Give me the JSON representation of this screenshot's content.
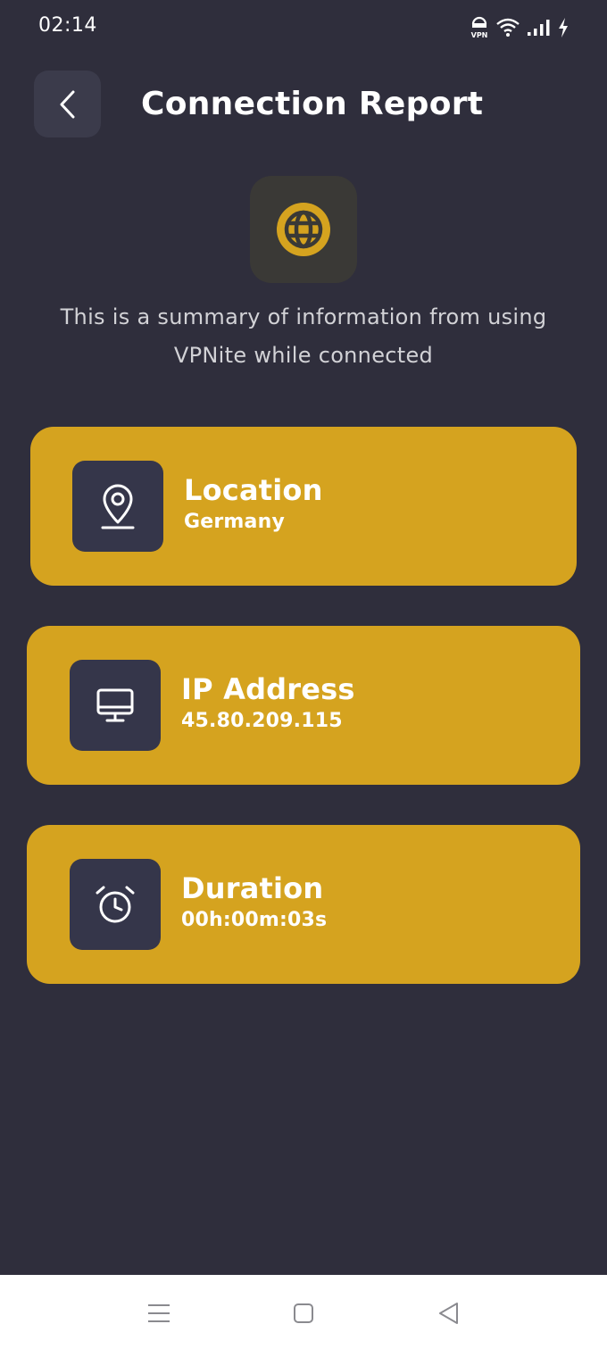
{
  "status_bar": {
    "time": "02:14",
    "icons": [
      "vpn-icon",
      "wifi-icon",
      "signal-icon",
      "charging-icon"
    ],
    "vpn_label": "VPN"
  },
  "header": {
    "title": "Connection Report",
    "back_icon": "chevron-left-icon"
  },
  "hero": {
    "icon": "globe-icon",
    "summary": "This is a summary of information from using VPNite while connected"
  },
  "cards": [
    {
      "title": "Location",
      "value": "Germany",
      "icon": "location-pin-icon"
    },
    {
      "title": "IP Address",
      "value": "45.80.209.115",
      "icon": "monitor-icon"
    },
    {
      "title": "Duration",
      "value": "00h:00m:03s",
      "icon": "alarm-clock-icon"
    }
  ],
  "nav_bar": {
    "buttons": [
      "menu-icon",
      "home-icon",
      "back-triangle-icon"
    ]
  },
  "colors": {
    "background": "#2f2e3c",
    "card": "#d5a31f",
    "icon_box": "#35364a",
    "accent": "#d5a31f",
    "text": "#ffffff"
  }
}
